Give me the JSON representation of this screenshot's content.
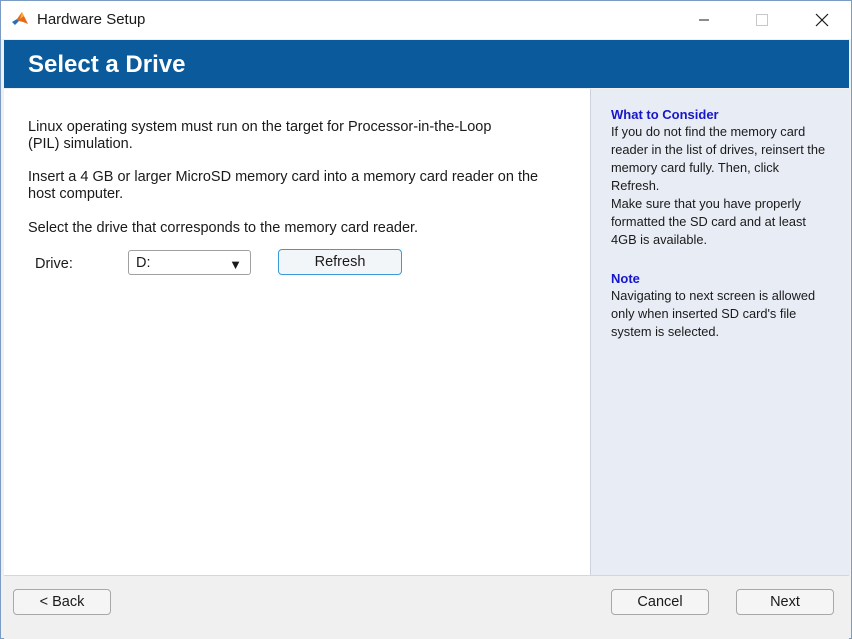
{
  "window": {
    "title": "Hardware Setup",
    "app_icon": "matlab-logo-icon",
    "controls": [
      "minimize-icon",
      "maximize-icon",
      "close-icon"
    ]
  },
  "banner": {
    "title": "Select a Drive"
  },
  "main": {
    "paragraph1_line1": "Linux operating system must run on the target for  Processor-in-the-Loop",
    "paragraph1_line2": "(PIL) simulation.",
    "paragraph2_line1": "Insert a 4 GB or larger MicroSD memory card into a memory card reader on the",
    "paragraph2_line2": "host computer.",
    "paragraph3": "Select the drive that corresponds to the memory card reader.",
    "drive_label": "Drive:",
    "drive_value": "D:",
    "refresh_label": "Refresh"
  },
  "side": {
    "consider_heading": "What to Consider",
    "consider_lines": [
      "If you do not find the memory card",
      "reader in the list of drives, reinsert the",
      "memory card fully. Then, click",
      "Refresh.",
      "Make sure that you have properly",
      "formatted the SD card and at least",
      "4GB is available."
    ],
    "note_heading": "Note",
    "note_lines": [
      "Navigating to next screen is allowed",
      "only when inserted SD card's file",
      "system is selected."
    ]
  },
  "footer": {
    "back_label": "< Back",
    "cancel_label": "Cancel",
    "next_label": "Next"
  },
  "colors": {
    "banner": "#0a5a9c",
    "side_panel": "#e8ecf4",
    "heading_blue": "#1717c8",
    "refresh_border": "#3a9bd9"
  }
}
